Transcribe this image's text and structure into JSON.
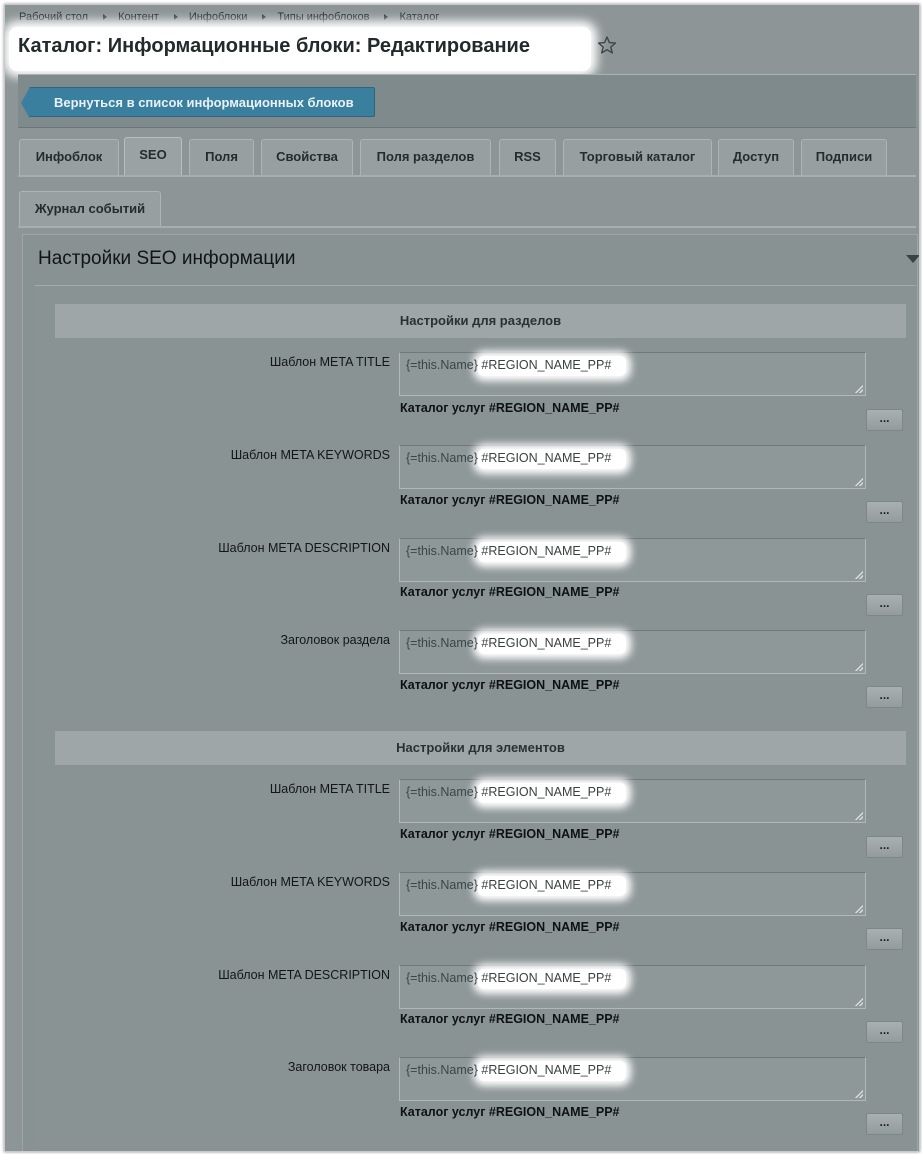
{
  "breadcrumb": [
    "Рабочий стол",
    "Контент",
    "Инфоблоки",
    "Типы инфоблоков",
    "Каталог"
  ],
  "page_title": "Каталог: Информационные блоки: Редактирование",
  "back_button_label": "Вернуться в список информационных блоков",
  "tabs": [
    "Инфоблок",
    "SEO",
    "Поля",
    "Свойства",
    "Поля разделов",
    "RSS",
    "Торговый каталог",
    "Доступ",
    "Подписи",
    "Журнал событий"
  ],
  "active_tab": "SEO",
  "section_title": "Настройки SEO информации",
  "groups": [
    {
      "title": "Настройки для разделов",
      "fields": [
        {
          "label": "Шаблон META TITLE",
          "value_part1": "{=this.Name}",
          "value_part2": "#REGION_NAME_PP#",
          "preview": "Каталог услуг #REGION_NAME_PP#",
          "button": "..."
        },
        {
          "label": "Шаблон META KEYWORDS",
          "value_part1": "{=this.Name}",
          "value_part2": "#REGION_NAME_PP#",
          "preview": "Каталог услуг #REGION_NAME_PP#",
          "button": "..."
        },
        {
          "label": "Шаблон META DESCRIPTION",
          "value_part1": "{=this.Name}",
          "value_part2": "#REGION_NAME_PP#",
          "preview": "Каталог услуг #REGION_NAME_PP#",
          "button": "..."
        },
        {
          "label": "Заголовок раздела",
          "value_part1": "{=this.Name}",
          "value_part2": "#REGION_NAME_PP#",
          "preview": "Каталог услуг #REGION_NAME_PP#",
          "button": "..."
        }
      ]
    },
    {
      "title": "Настройки для элементов",
      "fields": [
        {
          "label": "Шаблон META TITLE",
          "value_part1": "{=this.Name}",
          "value_part2": "#REGION_NAME_PP#",
          "preview": "Каталог услуг #REGION_NAME_PP#",
          "button": "..."
        },
        {
          "label": "Шаблон META KEYWORDS",
          "value_part1": "{=this.Name}",
          "value_part2": "#REGION_NAME_PP#",
          "preview": "Каталог услуг #REGION_NAME_PP#",
          "button": "..."
        },
        {
          "label": "Шаблон META DESCRIPTION",
          "value_part1": "{=this.Name}",
          "value_part2": "#REGION_NAME_PP#",
          "preview": "Каталог услуг #REGION_NAME_PP#",
          "button": "..."
        },
        {
          "label": "Заголовок товара",
          "value_part1": "{=this.Name}",
          "value_part2": "#REGION_NAME_PP#",
          "preview": "Каталог услуг #REGION_NAME_PP#",
          "button": "..."
        }
      ]
    }
  ],
  "icons": {
    "favorite": "star-icon",
    "collapse": "triangle-down-icon"
  },
  "colors": {
    "back_button": "#3b7f9e",
    "overlay": "#8d9596",
    "highlight": "#ffffff"
  }
}
